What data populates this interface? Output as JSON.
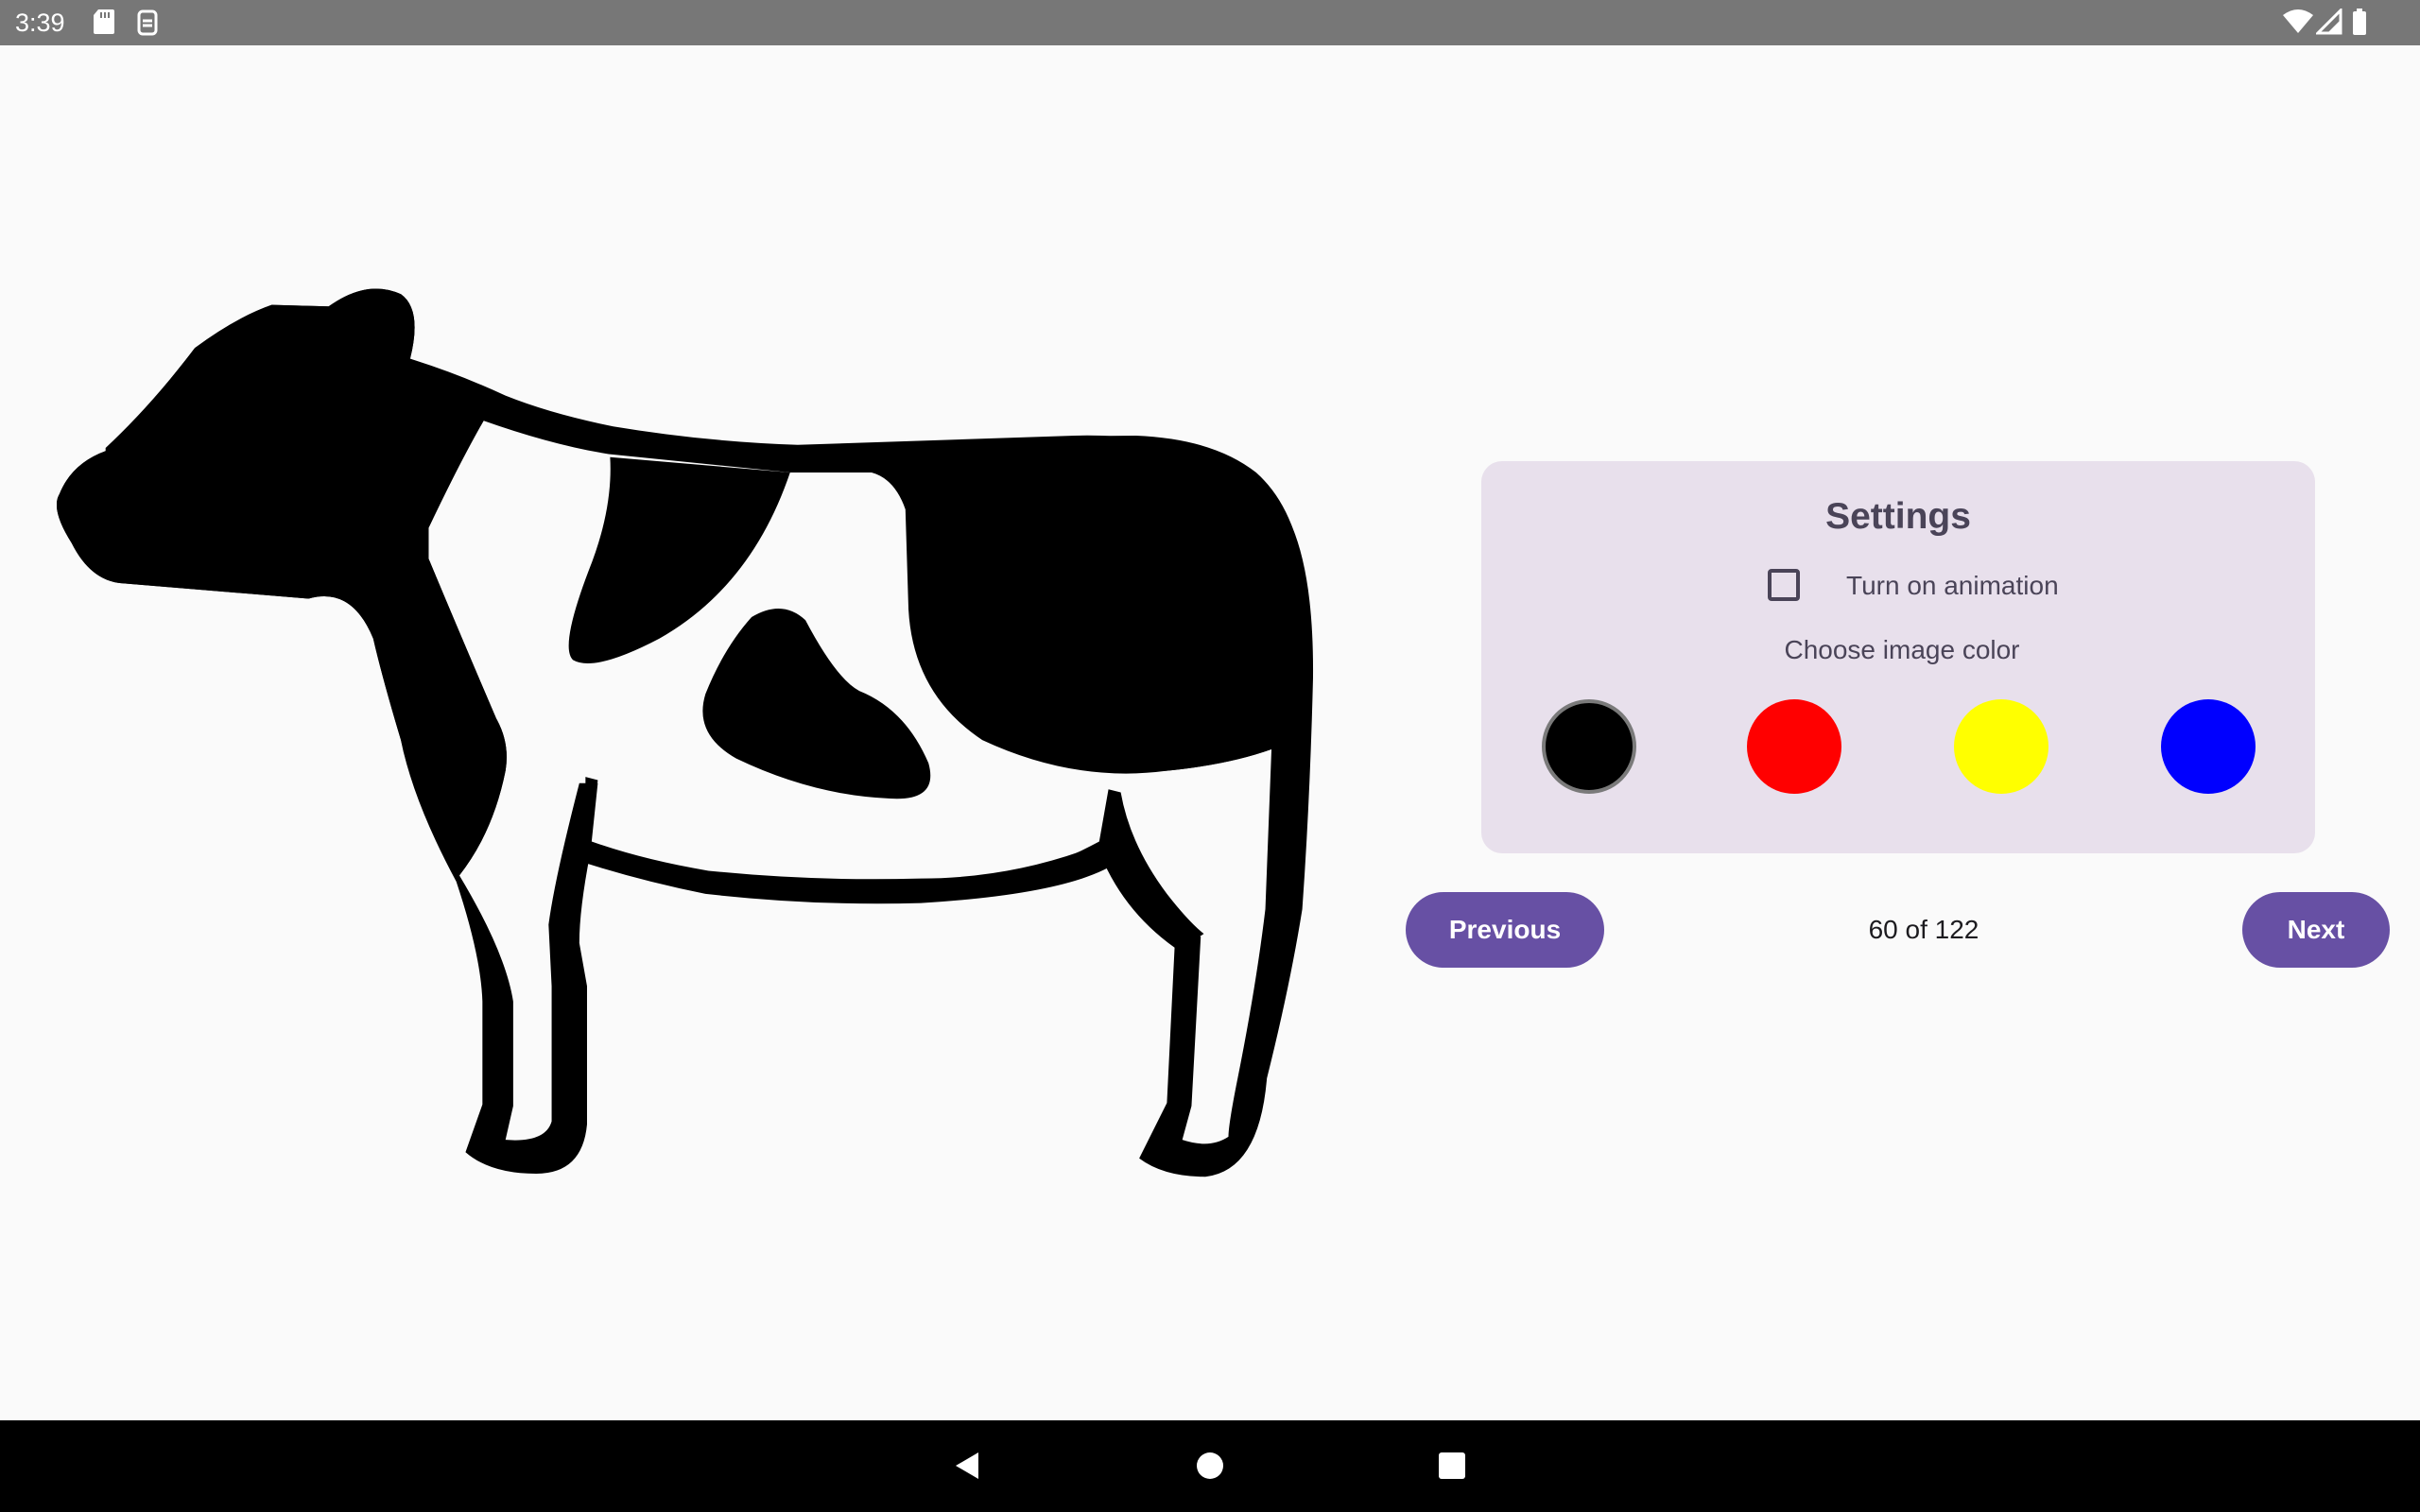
{
  "status_bar": {
    "time": "3:39",
    "left_icons": [
      "sd-card-icon",
      "sync-icon"
    ],
    "right_icons": [
      "wifi-icon",
      "cell-signal-icon",
      "battery-icon"
    ]
  },
  "main_image": {
    "subject": "cow",
    "fill_color": "#000000"
  },
  "settings": {
    "title": "Settings",
    "animation": {
      "label": "Turn on animation",
      "checked": false
    },
    "color_label": "Choose image color",
    "colors": [
      {
        "name": "black",
        "hex": "#000000",
        "selected": true
      },
      {
        "name": "red",
        "hex": "#ff0000",
        "selected": false
      },
      {
        "name": "yellow",
        "hex": "#ffff00",
        "selected": false
      },
      {
        "name": "blue",
        "hex": "#0000ff",
        "selected": false
      }
    ]
  },
  "navigation": {
    "previous_label": "Previous",
    "next_label": "Next",
    "counter": "60 of 122"
  },
  "system_nav": {
    "icons": [
      "back-icon",
      "home-icon",
      "recents-icon"
    ]
  },
  "theme": {
    "accent": "#6750a4",
    "card_bg": "#e8e0ec",
    "status_bar_bg": "#777777"
  }
}
